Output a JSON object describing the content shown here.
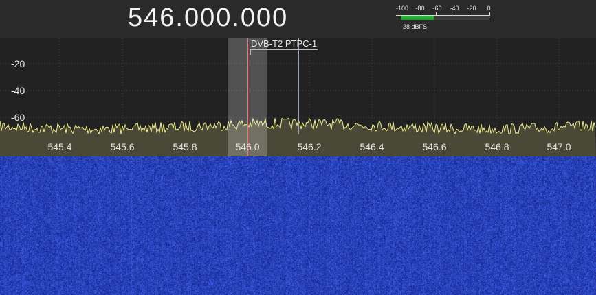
{
  "tuner": {
    "frequency_display": "546.000.000"
  },
  "signal_meter": {
    "scale_labels": [
      "-100",
      "-80",
      "-60",
      "-40",
      "-20",
      "0"
    ],
    "level_dbfs": -38,
    "readout": "-38 dBFS"
  },
  "spectrum": {
    "db_labels": [
      "-20",
      "-40",
      "-60"
    ],
    "freq_labels": [
      "545.4",
      "545.6",
      "545.8",
      "546.0",
      "546.2",
      "546.4",
      "546.6",
      "546.8",
      "547.0"
    ],
    "bookmark_label": "DVB-T2 PTPC-1",
    "trace_color": "#f2f08c",
    "tuned_color": "#ff6f6f",
    "marker_color": "#8fa2c8"
  },
  "waterfall": {
    "base_color": "#1c2fa8"
  }
}
